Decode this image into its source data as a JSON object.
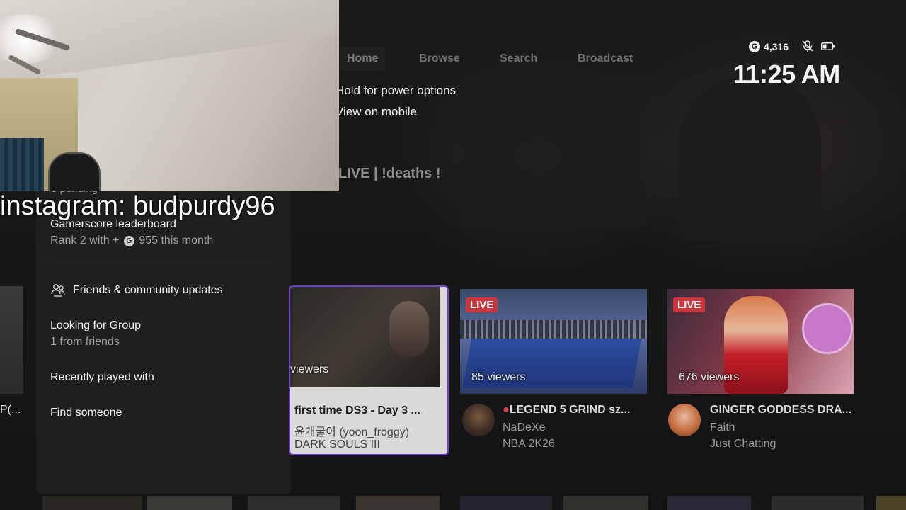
{
  "nav": {
    "tabs": [
      {
        "label": "Home"
      },
      {
        "label": "Browse"
      },
      {
        "label": "Search"
      },
      {
        "label": "Broadcast"
      }
    ]
  },
  "status": {
    "gamerscore": "4,316",
    "time": "11:25 AM",
    "gamerscore_badge": "G",
    "mic_icon": "mic-muted-icon",
    "battery_icon": "battery-icon"
  },
  "popup_menu": {
    "items": [
      "Hold for power options",
      "View on mobile"
    ]
  },
  "stream_title": "LIVE | !deaths !",
  "webcam_overlay": {
    "text": "instagram: budpurdy96"
  },
  "panel": {
    "pending_text": "3 pending",
    "leaderboard": {
      "title": "Gamerscore leaderboard",
      "rank_prefix": "Rank 2 with +",
      "badge": "G",
      "rank_suffix": "955 this month"
    },
    "friends_updates": "Friends & community updates",
    "lfg": {
      "title": "Looking for Group",
      "subtitle": "1 from friends"
    },
    "recently_played": "Recently played with",
    "find_someone": "Find someone"
  },
  "cards": {
    "partial": {
      "title": "P(..."
    },
    "focused": {
      "viewers": "viewers",
      "title": "first time DS3 - Day 3 ...",
      "channel": "윤개굴이 (yoon_froggy)",
      "game": "DARK SOULS III"
    },
    "nba": {
      "live": "LIVE",
      "viewers": "85 viewers",
      "title": "LEGEND 5 GRIND sz...",
      "channel": "NaDeXe",
      "game": "NBA 2K26"
    },
    "ginger": {
      "live": "LIVE",
      "viewers": "676 viewers",
      "title": "GINGER GODDESS DRA...",
      "channel": "Faith",
      "game": "Just Chatting"
    }
  },
  "colors": {
    "focus_outline": "#6d3fd0",
    "live_badge": "#c9363e",
    "panel_bg": "#1f1f1f"
  }
}
